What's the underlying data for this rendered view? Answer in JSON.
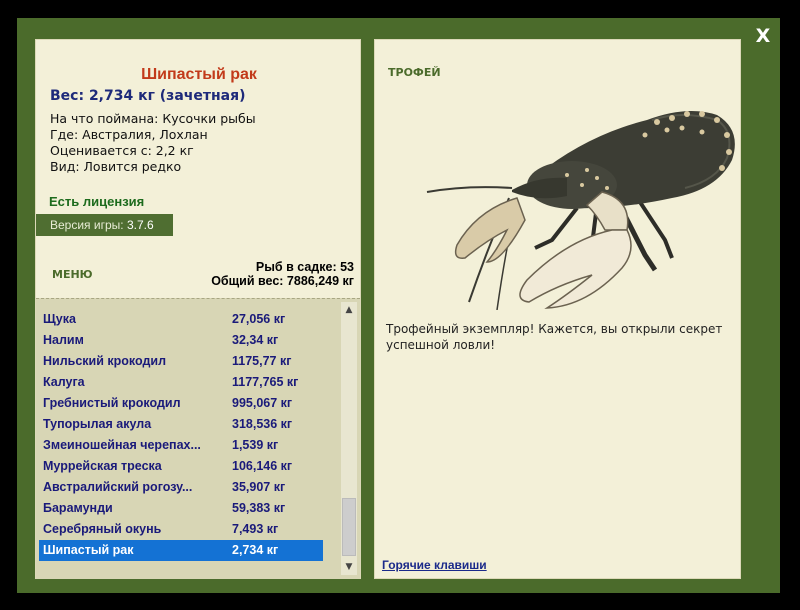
{
  "close_label": "X",
  "catch": {
    "title": "Шипастый рак",
    "weight_line": "Вес: 2,734 кг (зачетная)",
    "bait": "На что поймана: Кусочки рыбы",
    "location": "Где: Австралия, Лохлан",
    "value": "Оценивается с: 2,2 кг",
    "rarity": "Вид: Ловится редко"
  },
  "license_text": "Есть лицензия",
  "version": {
    "label": "Версия игры:",
    "number": "3.7.6"
  },
  "menu_label": "МЕНЮ",
  "stats": {
    "fish_in_cage": "Рыб в садке: 53",
    "total_weight": "Общий вес: 7886,249 кг"
  },
  "fish_list": [
    {
      "name": "Щука",
      "weight": "27,056 кг"
    },
    {
      "name": "Налим",
      "weight": "32,34 кг"
    },
    {
      "name": "Нильский крокодил",
      "weight": "1175,77 кг"
    },
    {
      "name": "Калуга",
      "weight": "1177,765 кг"
    },
    {
      "name": "Гребнистый крокодил",
      "weight": "995,067 кг"
    },
    {
      "name": "Тупорылая акула",
      "weight": "318,536 кг"
    },
    {
      "name": "Змеиношейная черепах...",
      "weight": "1,539 кг"
    },
    {
      "name": "Муррейская треска",
      "weight": "106,146 кг"
    },
    {
      "name": "Австралийский рогозу...",
      "weight": "35,907 кг"
    },
    {
      "name": "Барамунди",
      "weight": "59,383 кг"
    },
    {
      "name": "Серебряный окунь",
      "weight": "7,493 кг"
    },
    {
      "name": "Шипастый рак",
      "weight": "2,734 кг",
      "selected": true
    }
  ],
  "trophy": {
    "tag": "ТРОФЕЙ",
    "description": "Трофейный экземпляр! Кажется, вы открыли секрет успешной ловли!"
  },
  "hotkeys_label": "Горячие клавиши",
  "colors": {
    "frame": "#4b6b2b",
    "panel": "#f3f0d8",
    "title": "#c23a1a",
    "selection": "#1472d4"
  }
}
